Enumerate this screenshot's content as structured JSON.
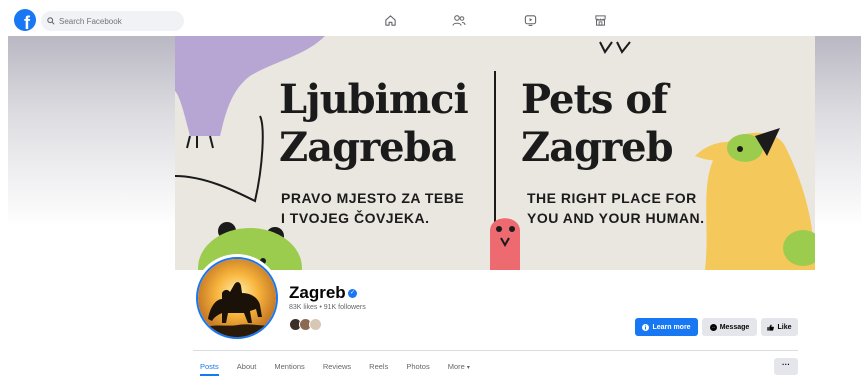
{
  "topbar": {
    "logo_letter": "f",
    "search_placeholder": "Search Facebook",
    "nav_icons": [
      "home-icon",
      "friends-icon",
      "watch-icon",
      "marketplace-icon"
    ]
  },
  "cover": {
    "title_hr_line1": "Ljubimci",
    "title_hr_line2": "Zagreba",
    "subtitle_hr_line1": "PRAVO MJESTO ZA TEBE",
    "subtitle_hr_line2": "I TVOJEG ČOVJEKA.",
    "title_en_line1": "Pets of",
    "title_en_line2": "Zagreb",
    "subtitle_en_line1": "THE RIGHT PLACE FOR",
    "subtitle_en_line2": "YOU AND YOUR HUMAN.",
    "colors": {
      "background": "#eae7e1",
      "purple": "#b7a6d4",
      "green": "#9ccc4d",
      "pink": "#ec6a70",
      "yellow": "#f4c85a"
    }
  },
  "profile": {
    "name": "Zagreb",
    "verified_mark": "✓",
    "stats": "83K likes • 91K followers"
  },
  "actions": {
    "learn_more": "Learn more",
    "message": "Message",
    "like": "Like"
  },
  "tabs": [
    "Posts",
    "About",
    "Mentions",
    "Reviews",
    "Reels",
    "Photos",
    "More"
  ],
  "more_caret": "▾",
  "dots_label": "···",
  "colors": {
    "brand": "#1877f2",
    "secondary_button": "#e4e6eb"
  }
}
